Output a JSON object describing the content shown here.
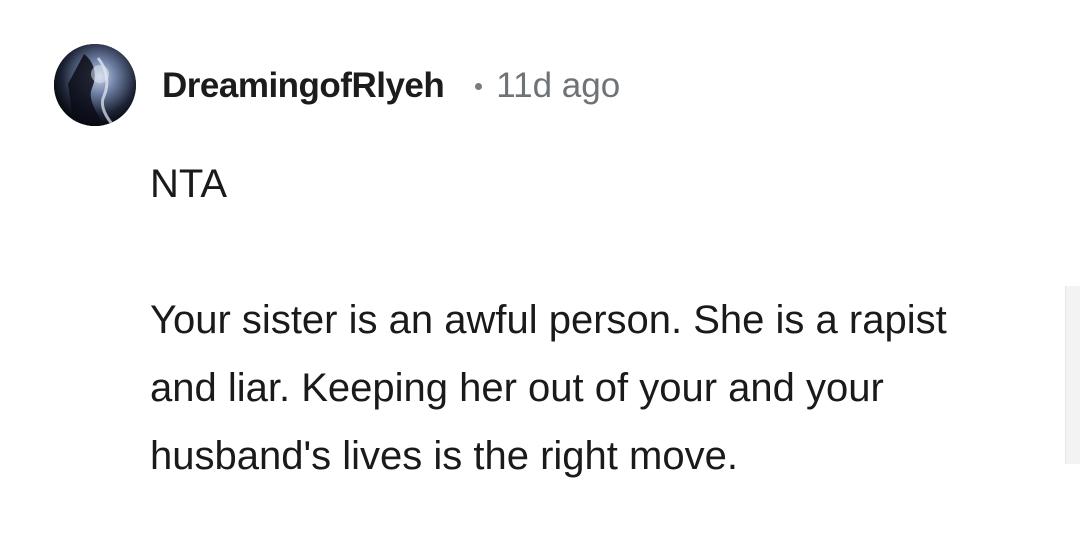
{
  "comment": {
    "avatar_icon": "user-avatar-dark",
    "username": "DreamingofRlyeh",
    "separator": "•",
    "timestamp": "11d ago",
    "verdict": "NTA",
    "body": "Your sister is an awful person. She is a rapist and liar. Keeping her out of your and your husband's lives is the right move."
  },
  "colors": {
    "username": "#1c1c1c",
    "timestamp": "#6e7377",
    "body_text": "#1a1a1b",
    "background": "#ffffff"
  }
}
